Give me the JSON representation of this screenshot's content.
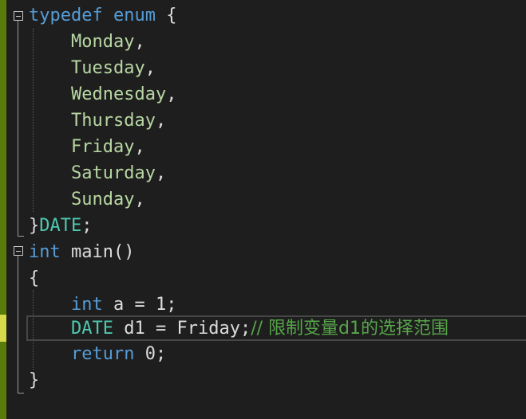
{
  "code": {
    "kw_typedef": "typedef",
    "kw_enum": "enum",
    "brace_open": "{",
    "enumerators": [
      "Monday",
      "Tuesday",
      "Wednesday",
      "Thursday",
      "Friday",
      "Saturday",
      "Sunday"
    ],
    "comma": ",",
    "brace_close": "}",
    "type_name": "DATE",
    "semicolon": ";",
    "kw_int": "int",
    "main_name": "main",
    "parens": "()",
    "var_a": "a",
    "equals": "=",
    "value_one": "1",
    "var_d1": "d1",
    "value_friday": "Friday",
    "comment": "// 限制变量d1的选择范围",
    "kw_return": "return",
    "value_zero": "0"
  },
  "colors": {
    "background": "#1e1e1e",
    "keyword": "#569cd6",
    "enum_member": "#b8d7a3",
    "type": "#4ec9b0",
    "plain": "#dcdcdc",
    "comment": "#57a64a",
    "change_bar": "#587c0c",
    "change_bar_active": "#d7d84a"
  }
}
